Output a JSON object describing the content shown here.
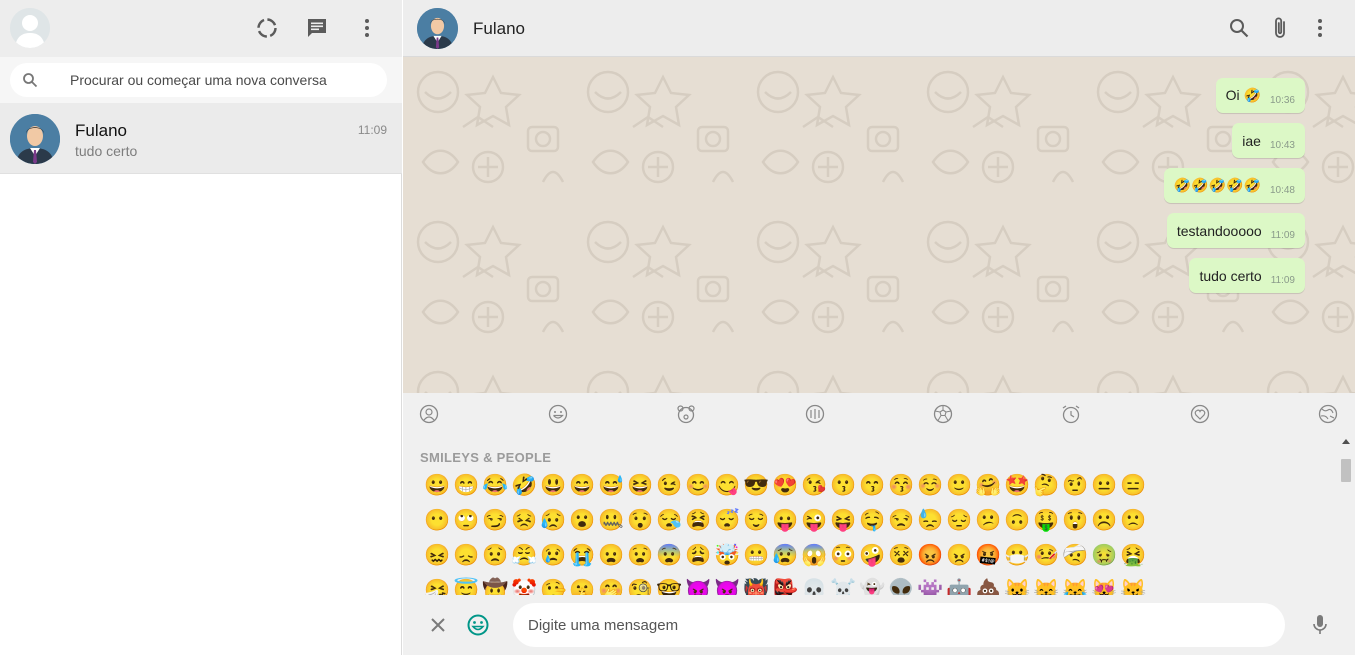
{
  "sidebar": {
    "search": {
      "placeholder": "Procurar ou começar uma nova conversa"
    },
    "chats": [
      {
        "name": "Fulano",
        "preview": "tudo certo",
        "time": "11:09"
      }
    ]
  },
  "conversation": {
    "contact_name": "Fulano",
    "messages": [
      {
        "text": "Oi 🤣",
        "time": "10:36"
      },
      {
        "text": "iae",
        "time": "10:43"
      },
      {
        "text": "🤣🤣🤣🤣🤣",
        "time": "10:48"
      },
      {
        "text": "testandooooo",
        "time": "11:09"
      },
      {
        "text": "tudo certo",
        "time": "11:09"
      }
    ]
  },
  "emoji_panel": {
    "category_icons": [
      "recent-icon",
      "smiley-icon",
      "animal-icon",
      "food-icon",
      "activity-icon",
      "travel-icon",
      "objects-icon",
      "flags-icon"
    ],
    "category_title": "SMILEYS & PEOPLE",
    "rows": [
      "😀 😁 😂 🤣 😃 😄 😅 😆 😉 😊 😋 😎 😍 😘 😗 😙 😚 ☺️ 🙂 🤗 🤩 🤔 🤨 😐 😑",
      "😶 🙄 😏 😣 😥 😮 🤐 😯 😪 😫 😴 😌 😛 😜 😝 🤤 😒 😓 😔 😕 🙃 🤑 😲 ☹️ 🙁",
      "😖 😞 😟 😤 😢 😭 😦 😧 😨 😩 🤯 😬 😰 😱 😳 🤪 😵 😡 😠 🤬 😷 🤒 🤕 🤢 🤮",
      "🤧 😇 🤠 🤡 🤥 🤫 🤭 🧐 🤓 😈 👿 👹 👺 💀 ☠️ 👻 👽 👾 🤖 💩 😺 😸 😹 😻 😼"
    ]
  },
  "composer": {
    "placeholder": "Digite uma mensagem"
  },
  "colors": {
    "outgoing_bubble": "#dcf8c6",
    "chat_background": "#e6ded3",
    "panel_header": "#ededed",
    "accent": "#009688"
  }
}
